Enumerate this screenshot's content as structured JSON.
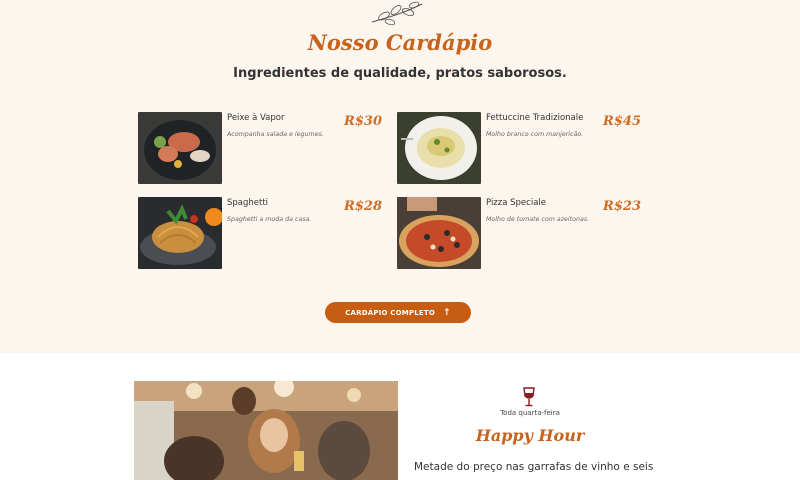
{
  "menu": {
    "title": "Nosso Cardápio",
    "subtitle": "Ingredientes de qualidade, pratos saborosos.",
    "items": [
      {
        "name": "Peixe à Vapor",
        "description": "Acompanha salada e legumes.",
        "price": "R$30",
        "image": "fish-dish-photo"
      },
      {
        "name": "Fettuccine Tradizionale",
        "description": "Molho branco com manjericão.",
        "price": "R$45",
        "image": "fettuccine-photo"
      },
      {
        "name": "Spaghetti",
        "description": "Spaghetti a moda da casa.",
        "price": "R$28",
        "image": "spaghetti-photo"
      },
      {
        "name": "Pizza Speciale",
        "description": "Molho de tomate com azeitonas.",
        "price": "R$23",
        "image": "pizza-photo"
      }
    ],
    "cta_label": "CARDÁPIO COMPLETO",
    "cta_icon": "arrow-up-icon"
  },
  "happy_hour": {
    "icon": "wine-glass-icon",
    "eyebrow": "Toda quarta-feira",
    "title": "Happy Hour",
    "text": "Metade do preço nas garrafas de vinho e seis"
  },
  "colors": {
    "accent": "#c9621a",
    "button": "#c75d12",
    "section_bg": "#fdf6ee"
  }
}
